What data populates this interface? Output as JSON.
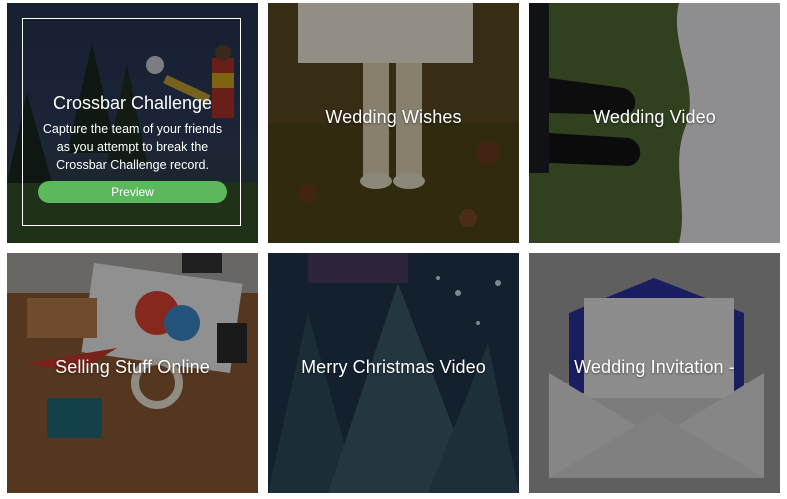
{
  "tiles": [
    {
      "title": "Crossbar Challenge",
      "description": "Capture the team of your friends as you attempt to break the Crossbar Challenge record.",
      "preview_label": "Preview"
    },
    {
      "title": "Wedding Wishes"
    },
    {
      "title": "Wedding Video"
    },
    {
      "title": "Selling Stuff Online"
    },
    {
      "title": "Merry Christmas Video"
    },
    {
      "title": "Wedding Invitation -"
    }
  ],
  "colors": {
    "preview_button": "#5cb85c",
    "overlay_text": "#ffffff"
  }
}
